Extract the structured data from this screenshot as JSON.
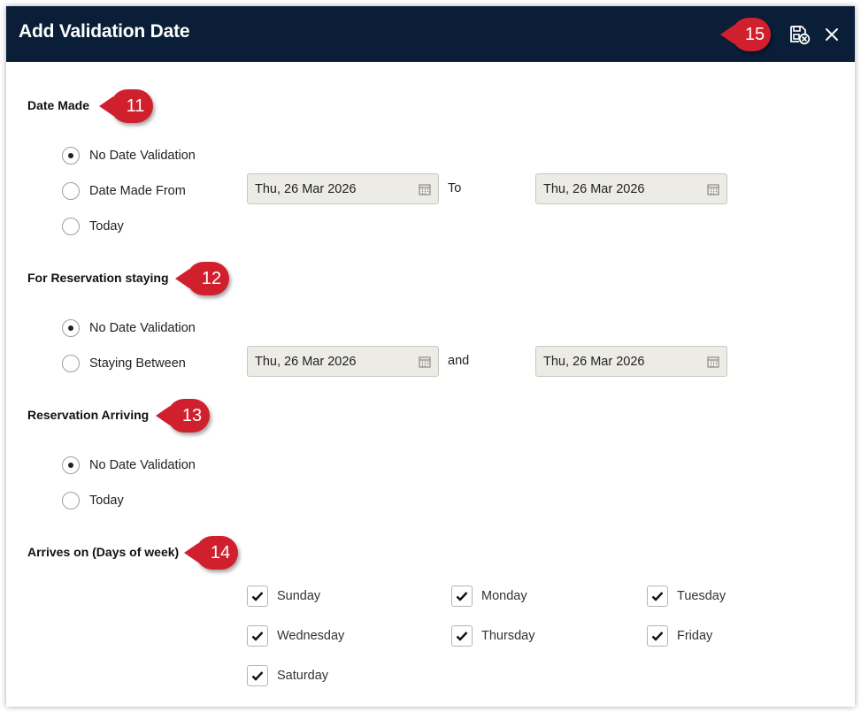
{
  "dialog": {
    "title": "Add Validation Date",
    "save_cancel_icon": "save-cancel-icon",
    "close_icon": "close-icon"
  },
  "date_made": {
    "title": "Date Made",
    "options": [
      "No Date Validation",
      "Date Made From",
      "Today"
    ],
    "selected": "No Date Validation",
    "from_value": "Thu, 26 Mar 2026",
    "separator": "To",
    "to_value": "Thu, 26 Mar 2026"
  },
  "reservation_staying": {
    "title": "For Reservation staying",
    "options": [
      "No Date Validation",
      "Staying Between"
    ],
    "selected": "No Date Validation",
    "from_value": "Thu, 26 Mar 2026",
    "separator": "and",
    "to_value": "Thu, 26 Mar 2026"
  },
  "reservation_arriving": {
    "title": "Reservation Arriving",
    "options": [
      "No Date Validation",
      "Today"
    ],
    "selected": "No Date Validation"
  },
  "arrives_on": {
    "title": "Arrives on (Days of week)",
    "days": [
      {
        "label": "Sunday",
        "checked": true
      },
      {
        "label": "Monday",
        "checked": true
      },
      {
        "label": "Tuesday",
        "checked": true
      },
      {
        "label": "Wednesday",
        "checked": true
      },
      {
        "label": "Thursday",
        "checked": true
      },
      {
        "label": "Friday",
        "checked": true
      },
      {
        "label": "Saturday",
        "checked": true
      }
    ]
  },
  "callouts": [
    "11",
    "12",
    "13",
    "14",
    "15"
  ],
  "colors": {
    "titlebar": "#0a1e38",
    "callout": "#d0202e",
    "date_field_bg": "#ecebe6"
  }
}
